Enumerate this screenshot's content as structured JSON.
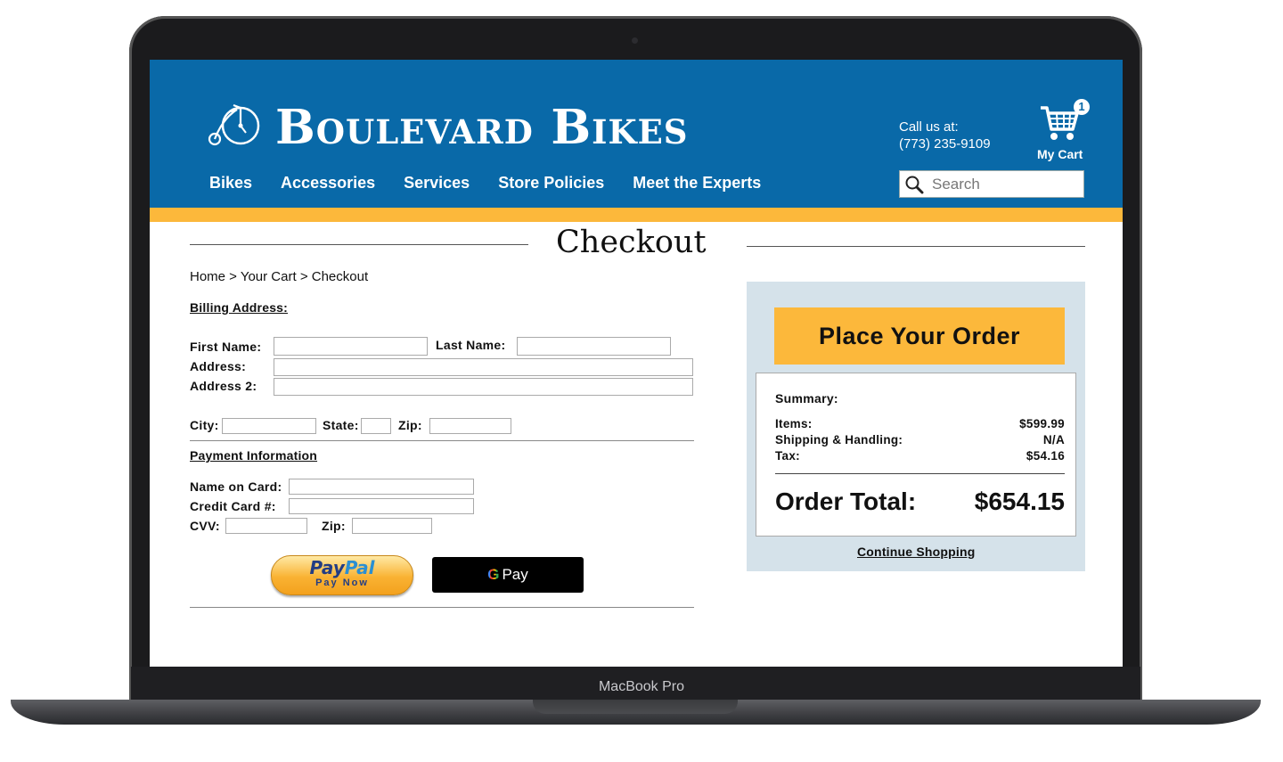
{
  "device": {
    "label": "MacBook Pro"
  },
  "header": {
    "site_name": "Boulevard Bikes",
    "nav": [
      "Bikes",
      "Accessories",
      "Services",
      "Store Policies",
      "Meet the Experts"
    ],
    "call_label": "Call us at:",
    "phone": "(773) 235-9109",
    "cart_count": "1",
    "cart_label": "My Cart",
    "search_placeholder": "Search"
  },
  "colors": {
    "header_blue": "#0969a8",
    "accent_orange": "#fcb83b",
    "summary_bg": "#d5e2ea"
  },
  "page": {
    "title": "Checkout",
    "breadcrumb": "Home > Your Cart > Checkout"
  },
  "billing": {
    "section_title": "Billing Address:",
    "first_name_label": "First Name:",
    "last_name_label": "Last Name:",
    "address_label": "Address:",
    "address2_label": "Address 2:",
    "city_label": "City:",
    "state_label": "State:",
    "zip_label": "Zip:"
  },
  "payment": {
    "section_title": "Payment Information",
    "name_on_card_label": "Name on Card:",
    "credit_card_label": "Credit Card #:",
    "cvv_label": "CVV:",
    "zip_label": "Zip:",
    "paypal_text_1": "Pay",
    "paypal_text_2": "Pal",
    "paypal_sub": "Pay Now",
    "gpay_g": "G",
    "gpay_text": "Pay"
  },
  "summary": {
    "place_order_label": "Place Your Order",
    "title": "Summary:",
    "items_label": "Items:",
    "items_value": "$599.99",
    "shipping_label": "Shipping & Handling:",
    "shipping_value": "N/A",
    "tax_label": "Tax:",
    "tax_value": "$54.16",
    "total_label": "Order Total:",
    "total_value": "$654.15",
    "continue_label": "Continue Shopping"
  }
}
